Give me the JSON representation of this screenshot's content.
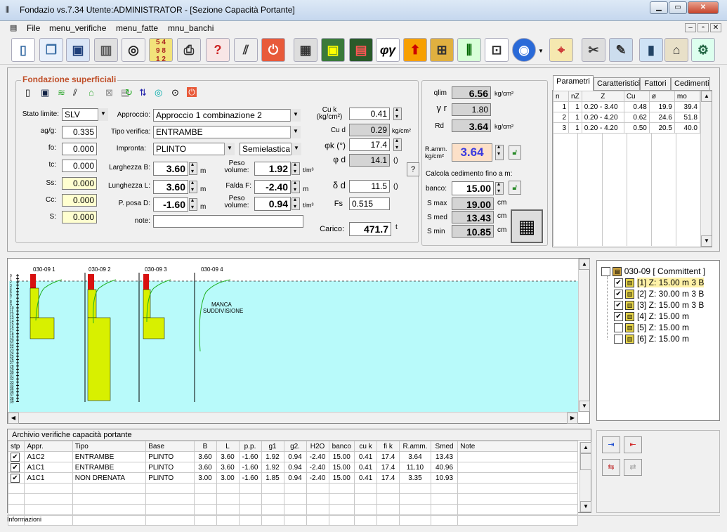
{
  "window": {
    "title": "Fondazio vs.7.34  Utente:ADMINISTRATOR - [Sezione Capacità Portante]",
    "min_label": "▁",
    "max_label": "▭",
    "close_label": "✕"
  },
  "menu": [
    "File",
    "menu_verifiche",
    "menu_fatte",
    "mnu_banchi"
  ],
  "mdi_controls": [
    "–",
    "▫",
    "✕"
  ],
  "foundation": {
    "group_title": "Fondazione superficiali",
    "stato_limite_label": "Stato limite:",
    "stato_limite": "SLV",
    "approccio_label": "Approccio:",
    "approccio": "Approccio 1 combinazione 2",
    "tipo_verifica_label": "Tipo verifica:",
    "tipo_verifica": "ENTRAMBE",
    "impronta_label": "Impronta:",
    "impronta": "PLINTO",
    "impronta_type": "Semielastica",
    "agfg_label": "ag/g:",
    "agfg": "0.335",
    "fo_label": "fo:",
    "fo": "0.000",
    "tc_label": "tc:",
    "tc": "0.000",
    "ss_label": "Ss:",
    "ss": "0.000",
    "cc_label": "Cc:",
    "cc": "0.000",
    "s_label": "S:",
    "s": "0.000",
    "larghezza_label": "Larghezza B:",
    "larghezza": "3.60",
    "lunghezza_label": "Lunghezza L:",
    "lunghezza": "3.60",
    "pposa_label": "P. posa D:",
    "pposa": "-1.60",
    "unit_m": "m",
    "peso1_label": "Peso volume:",
    "peso1": "1.92",
    "falda_label": "Falda F:",
    "falda": "-2.40",
    "peso2_label": "Peso volume:",
    "peso2": "0.94",
    "unit_tm3": "t/m³",
    "note_label": "note:",
    "note": "",
    "cuk_label": "Cu k (kg/cm²)",
    "cuk": "0.41",
    "cud_label": "Cu d",
    "cud": "0.29",
    "unit_kgcm2": "kg/cm²",
    "phik_label": "φk (°)",
    "phik": "17.4",
    "phid_label": "φ d",
    "phid": "14.1",
    "unit_paren": "()",
    "help_label": "?",
    "deltad_label": "δ d",
    "deltad": "11.5",
    "fs_label": "Fs",
    "fs": "0.515",
    "carico_label": "Carico:",
    "carico": "471.7",
    "unit_t": "t"
  },
  "results": {
    "qlim_label": "qlim",
    "qlim": "6.56",
    "unit": "kg/cm²",
    "gr_label": "γ r",
    "gr": "1.80",
    "rd_label": "Rd",
    "rd": "3.64",
    "ramm_label": "R.amm. kg/cm²",
    "ramm": "3.64",
    "calc_label": "Calcola cedimento fino a m:",
    "banco_label": "banco:",
    "banco": "15.00",
    "smax_label": "S max",
    "smax": "19.00",
    "smed_label": "S med",
    "smed": "13.43",
    "smin_label": "S min",
    "smin": "10.85",
    "unit_cm": "cm"
  },
  "tabs": [
    "Parametri",
    "Caratteristici",
    "Fattori",
    "Cedimenti"
  ],
  "params_table": {
    "headers": [
      "n",
      "nZ",
      "Z",
      "Cu",
      "ø",
      "mo"
    ],
    "rows": [
      [
        "1",
        "1",
        "0.20 - 3.40",
        "0.48",
        "19.9",
        "39.4"
      ],
      [
        "2",
        "1",
        "0.20 - 4.20",
        "0.62",
        "24.6",
        "51.8"
      ],
      [
        "3",
        "1",
        "0.20 - 4.20",
        "0.50",
        "20.5",
        "40.0"
      ]
    ]
  },
  "profile": {
    "labels": [
      "030-09 1",
      "030-09 2",
      "030-09 3",
      "030-09 4"
    ],
    "note": "MANCA SUDDIVISIONE",
    "depth_ticks": [
      "0",
      "1",
      "2",
      "3",
      "4",
      "5",
      "6",
      "7",
      "8",
      "9",
      "10",
      "11",
      "12",
      "13",
      "14",
      "15",
      "16",
      "17",
      "18",
      "19",
      "20",
      "21",
      "22",
      "23",
      "24",
      "25",
      "26",
      "27",
      "28",
      "29",
      "30",
      "31",
      "32",
      "33",
      "34",
      "35",
      "36",
      "37",
      "38",
      "39"
    ]
  },
  "tree": {
    "root": "030-09 [ Committent ]",
    "items": [
      {
        "label": "[1]  Z: 15.00 m   3 B",
        "checked": "✔",
        "hl": true
      },
      {
        "label": "[2]  Z: 30.00 m   3 B",
        "checked": "✔",
        "hl": false
      },
      {
        "label": "[3]  Z: 15.00 m   3 B",
        "checked": "✔",
        "hl": false
      },
      {
        "label": "[4]  Z: 15.00 m",
        "checked": "✔",
        "hl": false
      },
      {
        "label": "[5]  Z: 15.00 m",
        "checked": "",
        "hl": false
      },
      {
        "label": "[6]  Z: 15.00 m",
        "checked": "",
        "hl": false
      }
    ]
  },
  "archive": {
    "title": "Archivio verifiche capacità portante",
    "headers": [
      "stp",
      "Appr.",
      "Tipo",
      "Base",
      "B",
      "L",
      "p.p.",
      "g1",
      "g2.",
      "H2O",
      "banco",
      "cu k",
      "fi k",
      "R.amm.",
      "Smed",
      "Note"
    ],
    "rows": [
      [
        "✔",
        "A1C2",
        "ENTRAMBE",
        "PLINTO",
        "3.60",
        "3.60",
        "-1.60",
        "1.92",
        "0.94",
        "-2.40",
        "15.00",
        "0.41",
        "17.4",
        "3.64",
        "13.43",
        ""
      ],
      [
        "✔",
        "A1C1",
        "ENTRAMBE",
        "PLINTO",
        "3.60",
        "3.60",
        "-1.60",
        "1.92",
        "0.94",
        "-2.40",
        "15.00",
        "0.41",
        "17.4",
        "11.10",
        "40.96",
        ""
      ],
      [
        "✔",
        "A1C1",
        "NON DRENATA",
        "PLINTO",
        "3.00",
        "3.00",
        "-1.60",
        "1.85",
        "0.94",
        "-2.40",
        "15.00",
        "0.41",
        "17.4",
        "3.35",
        "10.93",
        ""
      ]
    ]
  },
  "status": "Informazioni"
}
